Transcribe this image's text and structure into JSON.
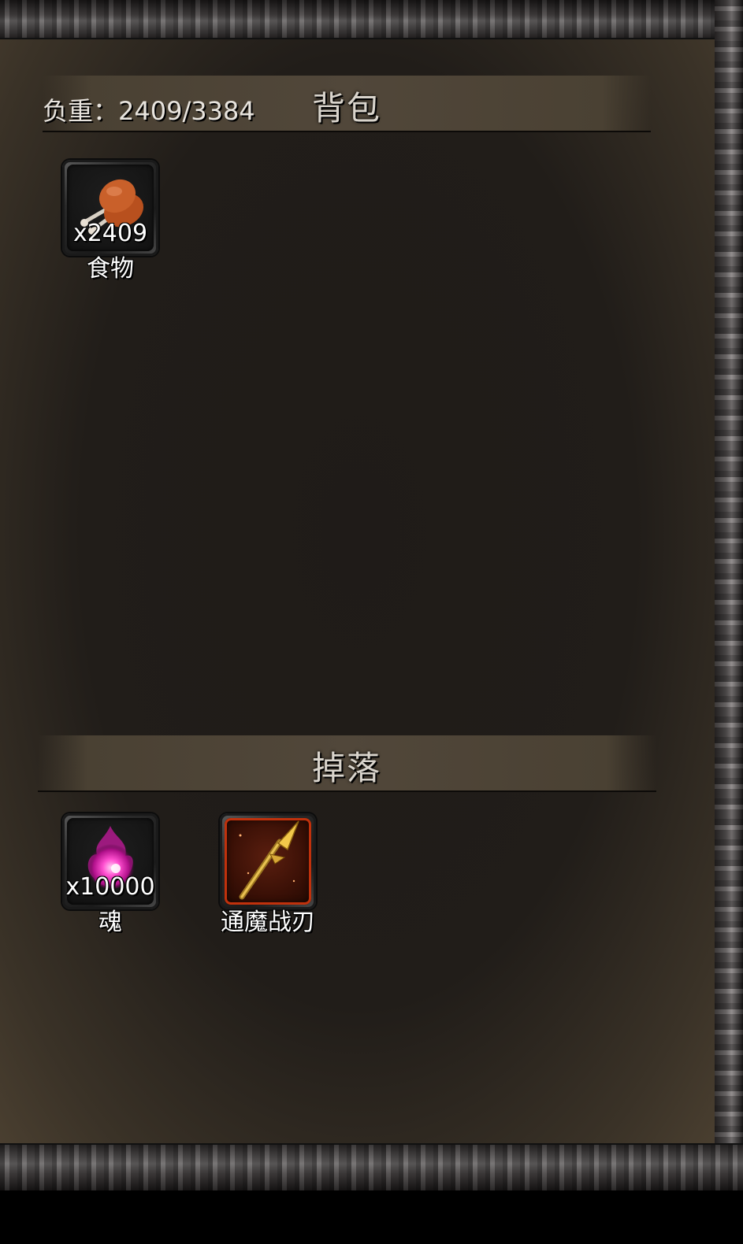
{
  "backpack": {
    "title": "背包",
    "weight_label": "负重：2409/3384",
    "items": [
      {
        "icon": "drumstick-icon",
        "quantity": "x2409",
        "name": "食物"
      }
    ]
  },
  "drops": {
    "title": "掉落",
    "items": [
      {
        "icon": "soul-orb-icon",
        "quantity": "x10000",
        "name": "魂"
      },
      {
        "icon": "golden-spear-icon",
        "quantity": "",
        "name": "通魔战刃"
      }
    ]
  }
}
